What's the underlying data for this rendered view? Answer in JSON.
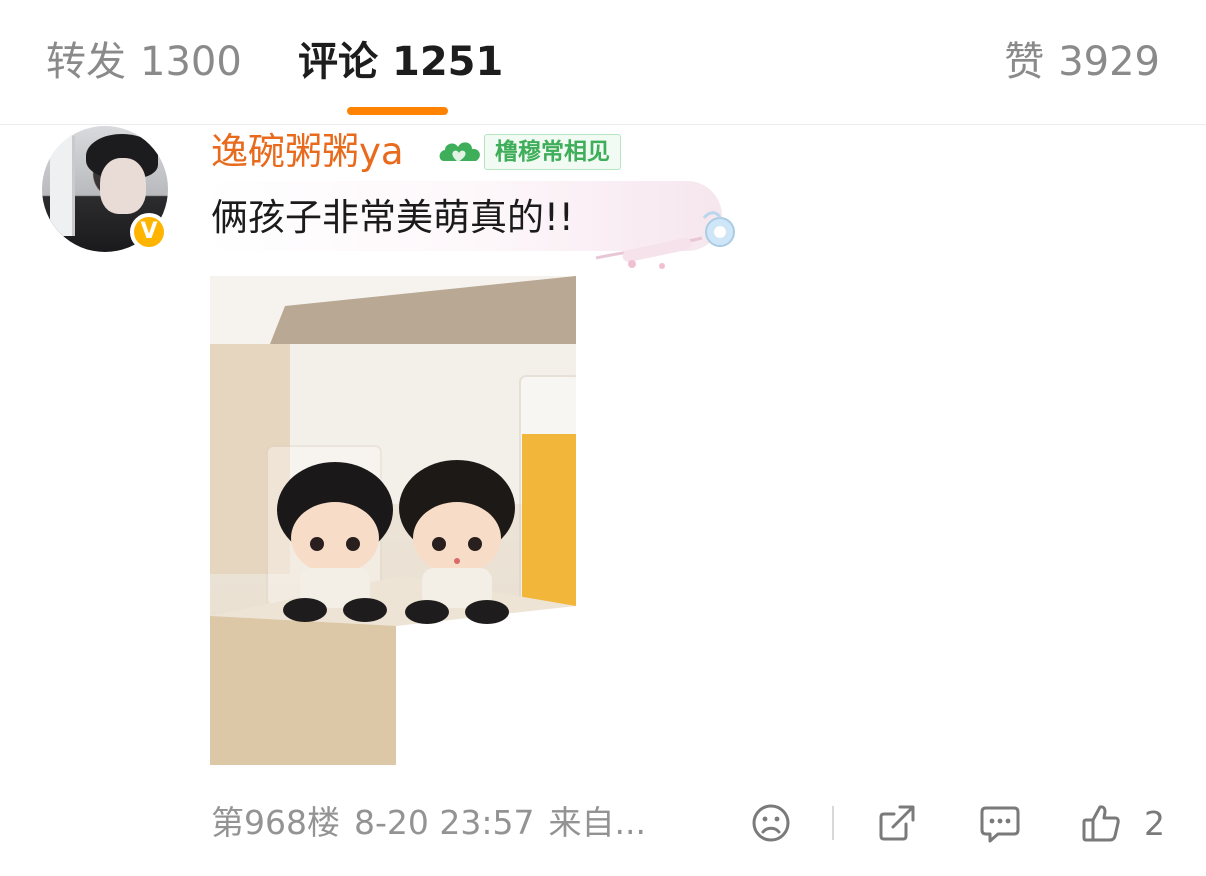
{
  "tabs": {
    "reposts": {
      "label": "转发",
      "count": "1300"
    },
    "comments": {
      "label": "评论",
      "count": "1251"
    },
    "likes": {
      "label": "赞",
      "count": "3929"
    },
    "active": "comments",
    "accent_color": "#ff8200"
  },
  "comment": {
    "username": "逸碗粥粥ya",
    "username_color": "#e86a1d",
    "verified_badge": "V",
    "fan_badge": {
      "icon": "cloud-heart-icon",
      "label": "橹穆常相见",
      "color": "#3fae5a"
    },
    "text": "俩孩子非常美萌真的!!",
    "photo": {
      "icon": "photo-two-figurines"
    },
    "meta": {
      "floor": "第968楼",
      "date": "8-20 23:57",
      "source": "来自..."
    },
    "actions": {
      "dislike_icon": "frown-face-icon",
      "share_icon": "share-icon",
      "reply_icon": "comment-bubble-icon",
      "like_icon": "thumbs-up-icon",
      "like_count": "2"
    }
  }
}
